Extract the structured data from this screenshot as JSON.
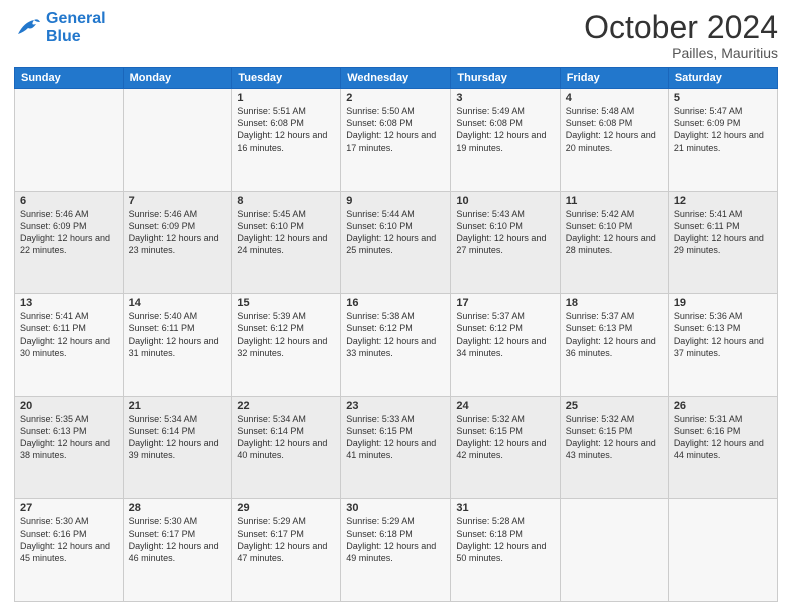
{
  "logo": {
    "line1": "General",
    "line2": "Blue"
  },
  "title": "October 2024",
  "location": "Pailles, Mauritius",
  "days_of_week": [
    "Sunday",
    "Monday",
    "Tuesday",
    "Wednesday",
    "Thursday",
    "Friday",
    "Saturday"
  ],
  "weeks": [
    [
      {
        "day": "",
        "sunrise": "",
        "sunset": "",
        "daylight": ""
      },
      {
        "day": "",
        "sunrise": "",
        "sunset": "",
        "daylight": ""
      },
      {
        "day": "1",
        "sunrise": "Sunrise: 5:51 AM",
        "sunset": "Sunset: 6:08 PM",
        "daylight": "Daylight: 12 hours and 16 minutes."
      },
      {
        "day": "2",
        "sunrise": "Sunrise: 5:50 AM",
        "sunset": "Sunset: 6:08 PM",
        "daylight": "Daylight: 12 hours and 17 minutes."
      },
      {
        "day": "3",
        "sunrise": "Sunrise: 5:49 AM",
        "sunset": "Sunset: 6:08 PM",
        "daylight": "Daylight: 12 hours and 19 minutes."
      },
      {
        "day": "4",
        "sunrise": "Sunrise: 5:48 AM",
        "sunset": "Sunset: 6:08 PM",
        "daylight": "Daylight: 12 hours and 20 minutes."
      },
      {
        "day": "5",
        "sunrise": "Sunrise: 5:47 AM",
        "sunset": "Sunset: 6:09 PM",
        "daylight": "Daylight: 12 hours and 21 minutes."
      }
    ],
    [
      {
        "day": "6",
        "sunrise": "Sunrise: 5:46 AM",
        "sunset": "Sunset: 6:09 PM",
        "daylight": "Daylight: 12 hours and 22 minutes."
      },
      {
        "day": "7",
        "sunrise": "Sunrise: 5:46 AM",
        "sunset": "Sunset: 6:09 PM",
        "daylight": "Daylight: 12 hours and 23 minutes."
      },
      {
        "day": "8",
        "sunrise": "Sunrise: 5:45 AM",
        "sunset": "Sunset: 6:10 PM",
        "daylight": "Daylight: 12 hours and 24 minutes."
      },
      {
        "day": "9",
        "sunrise": "Sunrise: 5:44 AM",
        "sunset": "Sunset: 6:10 PM",
        "daylight": "Daylight: 12 hours and 25 minutes."
      },
      {
        "day": "10",
        "sunrise": "Sunrise: 5:43 AM",
        "sunset": "Sunset: 6:10 PM",
        "daylight": "Daylight: 12 hours and 27 minutes."
      },
      {
        "day": "11",
        "sunrise": "Sunrise: 5:42 AM",
        "sunset": "Sunset: 6:10 PM",
        "daylight": "Daylight: 12 hours and 28 minutes."
      },
      {
        "day": "12",
        "sunrise": "Sunrise: 5:41 AM",
        "sunset": "Sunset: 6:11 PM",
        "daylight": "Daylight: 12 hours and 29 minutes."
      }
    ],
    [
      {
        "day": "13",
        "sunrise": "Sunrise: 5:41 AM",
        "sunset": "Sunset: 6:11 PM",
        "daylight": "Daylight: 12 hours and 30 minutes."
      },
      {
        "day": "14",
        "sunrise": "Sunrise: 5:40 AM",
        "sunset": "Sunset: 6:11 PM",
        "daylight": "Daylight: 12 hours and 31 minutes."
      },
      {
        "day": "15",
        "sunrise": "Sunrise: 5:39 AM",
        "sunset": "Sunset: 6:12 PM",
        "daylight": "Daylight: 12 hours and 32 minutes."
      },
      {
        "day": "16",
        "sunrise": "Sunrise: 5:38 AM",
        "sunset": "Sunset: 6:12 PM",
        "daylight": "Daylight: 12 hours and 33 minutes."
      },
      {
        "day": "17",
        "sunrise": "Sunrise: 5:37 AM",
        "sunset": "Sunset: 6:12 PM",
        "daylight": "Daylight: 12 hours and 34 minutes."
      },
      {
        "day": "18",
        "sunrise": "Sunrise: 5:37 AM",
        "sunset": "Sunset: 6:13 PM",
        "daylight": "Daylight: 12 hours and 36 minutes."
      },
      {
        "day": "19",
        "sunrise": "Sunrise: 5:36 AM",
        "sunset": "Sunset: 6:13 PM",
        "daylight": "Daylight: 12 hours and 37 minutes."
      }
    ],
    [
      {
        "day": "20",
        "sunrise": "Sunrise: 5:35 AM",
        "sunset": "Sunset: 6:13 PM",
        "daylight": "Daylight: 12 hours and 38 minutes."
      },
      {
        "day": "21",
        "sunrise": "Sunrise: 5:34 AM",
        "sunset": "Sunset: 6:14 PM",
        "daylight": "Daylight: 12 hours and 39 minutes."
      },
      {
        "day": "22",
        "sunrise": "Sunrise: 5:34 AM",
        "sunset": "Sunset: 6:14 PM",
        "daylight": "Daylight: 12 hours and 40 minutes."
      },
      {
        "day": "23",
        "sunrise": "Sunrise: 5:33 AM",
        "sunset": "Sunset: 6:15 PM",
        "daylight": "Daylight: 12 hours and 41 minutes."
      },
      {
        "day": "24",
        "sunrise": "Sunrise: 5:32 AM",
        "sunset": "Sunset: 6:15 PM",
        "daylight": "Daylight: 12 hours and 42 minutes."
      },
      {
        "day": "25",
        "sunrise": "Sunrise: 5:32 AM",
        "sunset": "Sunset: 6:15 PM",
        "daylight": "Daylight: 12 hours and 43 minutes."
      },
      {
        "day": "26",
        "sunrise": "Sunrise: 5:31 AM",
        "sunset": "Sunset: 6:16 PM",
        "daylight": "Daylight: 12 hours and 44 minutes."
      }
    ],
    [
      {
        "day": "27",
        "sunrise": "Sunrise: 5:30 AM",
        "sunset": "Sunset: 6:16 PM",
        "daylight": "Daylight: 12 hours and 45 minutes."
      },
      {
        "day": "28",
        "sunrise": "Sunrise: 5:30 AM",
        "sunset": "Sunset: 6:17 PM",
        "daylight": "Daylight: 12 hours and 46 minutes."
      },
      {
        "day": "29",
        "sunrise": "Sunrise: 5:29 AM",
        "sunset": "Sunset: 6:17 PM",
        "daylight": "Daylight: 12 hours and 47 minutes."
      },
      {
        "day": "30",
        "sunrise": "Sunrise: 5:29 AM",
        "sunset": "Sunset: 6:18 PM",
        "daylight": "Daylight: 12 hours and 49 minutes."
      },
      {
        "day": "31",
        "sunrise": "Sunrise: 5:28 AM",
        "sunset": "Sunset: 6:18 PM",
        "daylight": "Daylight: 12 hours and 50 minutes."
      },
      {
        "day": "",
        "sunrise": "",
        "sunset": "",
        "daylight": ""
      },
      {
        "day": "",
        "sunrise": "",
        "sunset": "",
        "daylight": ""
      }
    ]
  ]
}
